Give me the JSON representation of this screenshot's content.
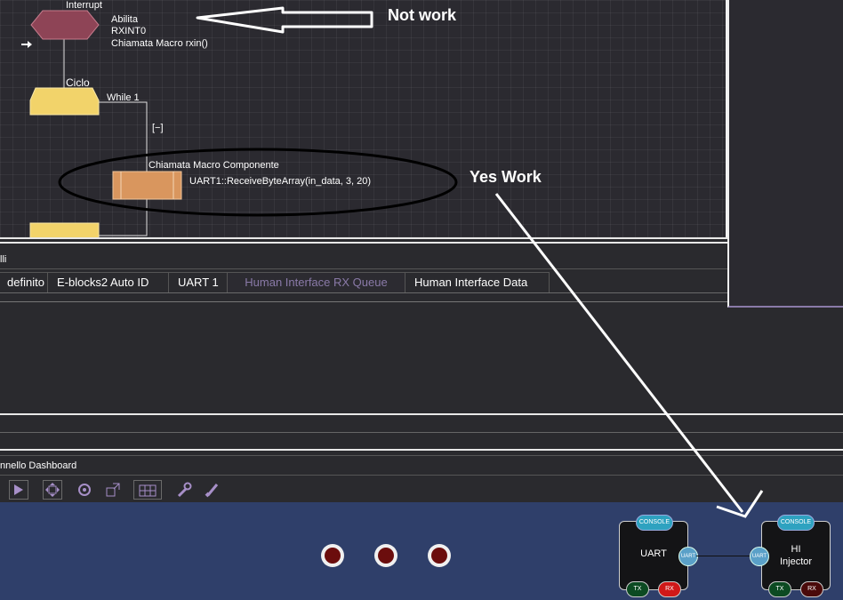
{
  "flowchart": {
    "interrupt_title": "Interrupt",
    "interrupt_lines": [
      "Abilita",
      "RXINT0",
      "Chiamata Macro rxin()"
    ],
    "loop_title": "Ciclo",
    "loop_condition": "While 1",
    "collapse_toggle": "[−]",
    "macro_title": "Chiamata Macro Componente",
    "macro_call": "UART1::ReceiveByteArray(in_data, 3, 20)"
  },
  "annotations": {
    "not_work": "Not work",
    "yes_work": "Yes Work"
  },
  "properties_panel": {
    "title": "lli",
    "tabs": [
      "definito",
      "E-blocks2 Auto ID",
      "UART 1",
      "Human Interface RX Queue",
      "Human Interface Data"
    ],
    "active_tab_index": 3
  },
  "dashboard": {
    "title": "nnello Dashboard",
    "tools": [
      "pointer-icon",
      "move-icon",
      "rotate-icon",
      "resize-icon",
      "grid-icon",
      "wrench-icon",
      "brush-icon"
    ],
    "leds": [
      {
        "name": "led-1",
        "color": "#6b0d0d"
      },
      {
        "name": "led-2",
        "color": "#6b0d0d"
      },
      {
        "name": "led-3",
        "color": "#6b0d0d"
      }
    ],
    "uart_component": {
      "label": "UART",
      "console": "CONSOLE",
      "pin": "UART",
      "tx": "TX",
      "rx": "RX"
    },
    "injector_component": {
      "label_line1": "HI",
      "label_line2": "Injector",
      "console": "CONSOLE",
      "pin": "UART",
      "tx": "TX",
      "rx": "RX"
    }
  },
  "colors": {
    "canvas_bg": "#2b2a30",
    "dashboard_bg": "#2f3f6a",
    "accent_purple": "#a78fc8",
    "interrupt_shape": "#8e4456",
    "loop_shape": "#f2d36a",
    "macro_shape": "#d9965e"
  }
}
